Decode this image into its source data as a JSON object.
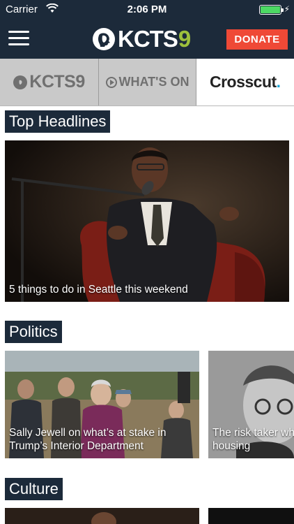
{
  "status_bar": {
    "carrier": "Carrier",
    "time": "2:06 PM",
    "battery_color": "#4cd964"
  },
  "header": {
    "brand_text": "KCTS",
    "brand_number": "9",
    "donate_label": "DONATE",
    "colors": {
      "bar": "#1c2a3a",
      "donate": "#ef4936",
      "brand_number": "#9dc03c"
    }
  },
  "tabs": [
    {
      "label": "KCTS9",
      "icon": "pbs-head-icon"
    },
    {
      "label": "WHAT'S ON",
      "icon": "play-circle-icon"
    },
    {
      "label": "Crosscut",
      "suffix": ".",
      "selected": true
    }
  ],
  "sections": {
    "top_headlines": {
      "title": "Top Headlines",
      "cards": [
        {
          "caption": "5 things to do in Seattle this weekend"
        }
      ]
    },
    "politics": {
      "title": "Politics",
      "cards": [
        {
          "caption": "Sally Jewell on what’s at stake in Trump’s Interior Department"
        },
        {
          "caption": "The risk taker wh housing"
        }
      ]
    },
    "culture": {
      "title": "Culture"
    }
  }
}
